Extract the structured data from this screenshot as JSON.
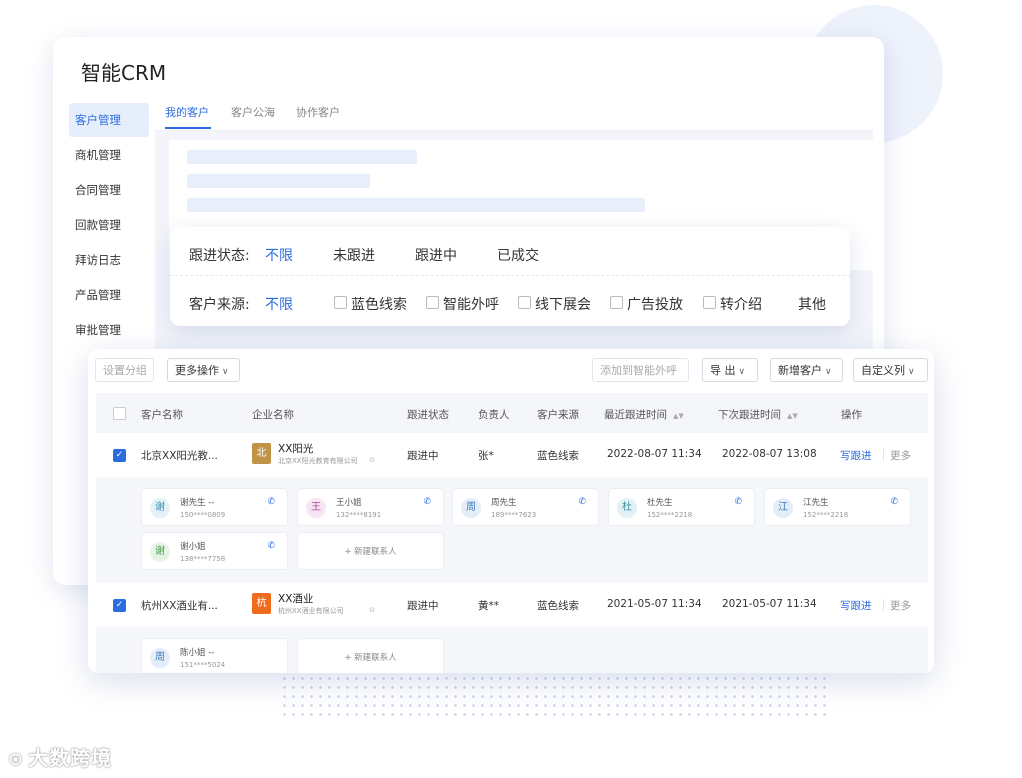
{
  "colors": {
    "accent": "#2b6de0",
    "logo_bei": "#c09346",
    "logo_hang": "#ef6c1f"
  },
  "app": {
    "title": "智能CRM"
  },
  "sidebar": {
    "items": [
      {
        "label": "客户管理"
      },
      {
        "label": "商机管理"
      },
      {
        "label": "合同管理"
      },
      {
        "label": "回款管理"
      },
      {
        "label": "拜访日志"
      },
      {
        "label": "产品管理"
      },
      {
        "label": "审批管理"
      }
    ]
  },
  "tabs": [
    {
      "label": "我的客户"
    },
    {
      "label": "客户公海"
    },
    {
      "label": "协作客户"
    }
  ],
  "filters": {
    "status": {
      "label": "跟进状态:",
      "options": [
        "不限",
        "未跟进",
        "跟进中",
        "已成交"
      ]
    },
    "source": {
      "label": "客户来源:",
      "options": [
        "不限",
        "蓝色线索",
        "智能外呼",
        "线下展会",
        "广告投放",
        "转介绍",
        "其他"
      ]
    }
  },
  "toolbar": {
    "set_group": "设置分组",
    "more_actions": "更多操作",
    "add_to_call": "添加到智能外呼",
    "export": "导 出",
    "new_customer": "新增客户",
    "custom_columns": "自定义列"
  },
  "table": {
    "headers": [
      "客户名称",
      "企业名称",
      "跟进状态",
      "负责人",
      "客户来源",
      "最近跟进时间",
      "下次跟进时间",
      "操作"
    ],
    "rows": [
      {
        "customer": "北京XX阳光教...",
        "logo_char": "北",
        "company": "XX阳光",
        "company_full": "北京XX阳光教育有限公司",
        "status": "跟进中",
        "owner": "张*",
        "source": "蓝色线索",
        "last_follow": "2022-08-07 11:34",
        "next_follow": "2022-08-07 13:08",
        "op_follow": "写跟进",
        "op_more": "更多",
        "contacts": [
          {
            "avatar": "谢",
            "name": "谢先生 --",
            "phone": "150****0809"
          },
          {
            "avatar": "王",
            "name": "王小姐",
            "phone": "132****8191"
          },
          {
            "avatar": "周",
            "name": "周先生",
            "phone": "189****7623"
          },
          {
            "avatar": "杜",
            "name": "杜先生",
            "phone": "152****2218"
          },
          {
            "avatar": "江",
            "name": "江先生",
            "phone": "152****2218"
          },
          {
            "avatar": "谢",
            "name": "谢小姐",
            "phone": "138****7758"
          }
        ],
        "add_contact": "+ 新建联系人"
      },
      {
        "customer": "杭州XX酒业有...",
        "logo_char": "杭",
        "company": "XX酒业",
        "company_full": "杭州XX酒业有限公司",
        "status": "跟进中",
        "owner": "黄**",
        "source": "蓝色线索",
        "last_follow": "2021-05-07 11:34",
        "next_follow": "2021-05-07 11:34",
        "op_follow": "写跟进",
        "op_more": "更多",
        "contacts": [
          {
            "avatar": "周",
            "name": "陈小姐 --",
            "phone": "151****5024"
          }
        ],
        "add_contact": "+ 新建联系人"
      }
    ]
  },
  "icons": {
    "phone": "phone-icon",
    "check": "check-icon",
    "caret": "caret-down-icon",
    "sort": "sort-icon",
    "info": "info-dot-icon"
  },
  "watermark": "大数跨境"
}
